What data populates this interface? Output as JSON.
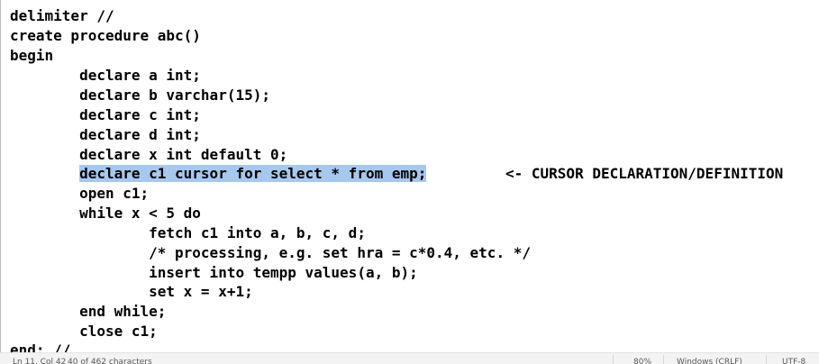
{
  "editor": {
    "lines": [
      "delimiter //",
      "create procedure abc()",
      "begin",
      "        declare a int;",
      "        declare b varchar(15);",
      "        declare c int;",
      "        declare d int;",
      "        declare x int default 0;",
      "        ",
      "        open c1;",
      "        while x < 5 do",
      "                fetch c1 into a, b, c, d;",
      "                /* processing, e.g. set hra = c*0.4, etc. */",
      "                insert into tempp values(a, b);",
      "                set x = x+1;",
      "        end while;",
      "        close c1;",
      "end; //"
    ],
    "highlighted_text": "declare c1 cursor for select * from emp;",
    "highlight_color": "#a6c8ec",
    "annotation": "<- CURSOR DECLARATION/DEFINITION"
  },
  "statusbar": {
    "position": "Ln 11, Col 42",
    "char_count": "40 of 462 characters",
    "zoom": "80%",
    "line_ending": "Windows (CRLF)",
    "encoding": "UTF-8"
  }
}
